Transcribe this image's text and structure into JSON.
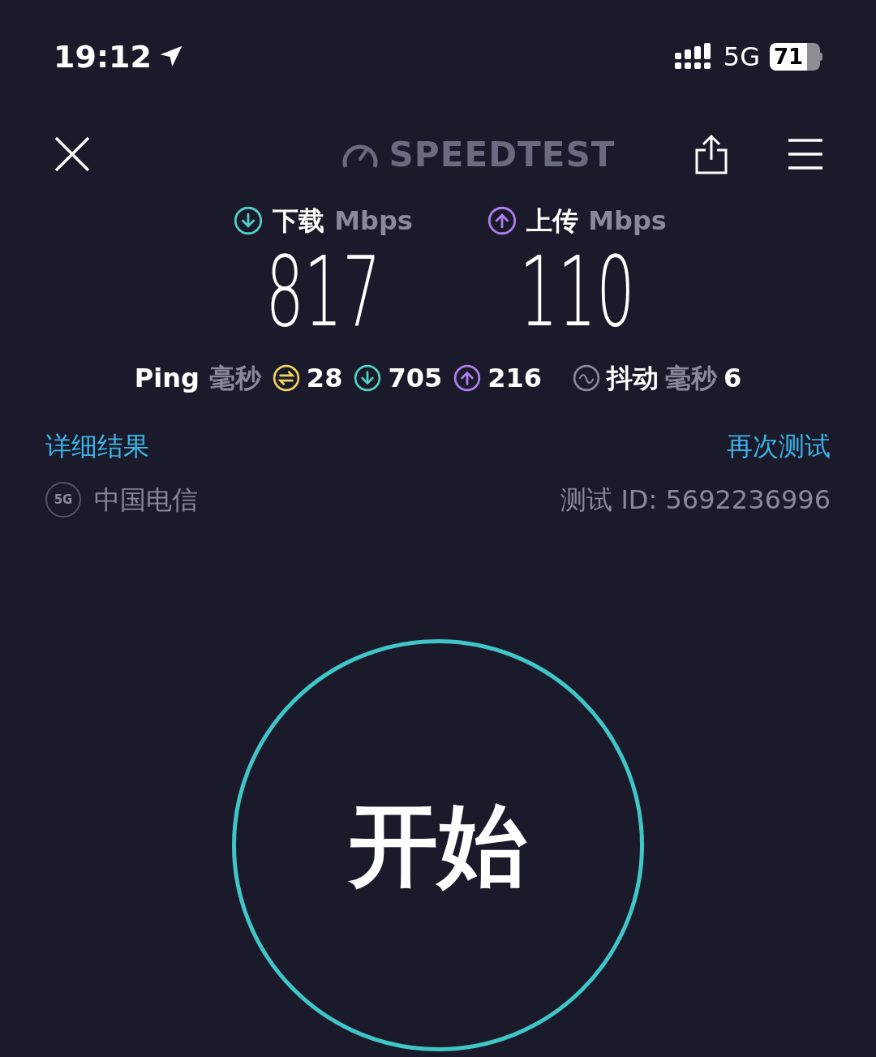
{
  "status_bar": {
    "time": "19:12",
    "network": "5G",
    "battery": "71"
  },
  "header": {
    "logo": "SPEEDTEST"
  },
  "results": [
    {
      "kind": "download",
      "label": "下载",
      "unit": "Mbps",
      "value": "817"
    },
    {
      "kind": "upload",
      "label": "上传",
      "unit": "Mbps",
      "value": "110"
    }
  ],
  "ping": {
    "label": "Ping",
    "unit": "毫秒",
    "items": [
      {
        "kind": "idle",
        "value": "28"
      },
      {
        "kind": "download",
        "value": "705"
      },
      {
        "kind": "upload",
        "value": "216"
      }
    ]
  },
  "jitter": {
    "label": "抖动",
    "unit": "毫秒",
    "value": "6"
  },
  "links": {
    "details": "详细结果",
    "retest": "再次测试"
  },
  "provider": {
    "badge": "5G",
    "name": "中国电信"
  },
  "test_id": "测试 ID: 5692236996",
  "start_button": "开始"
}
